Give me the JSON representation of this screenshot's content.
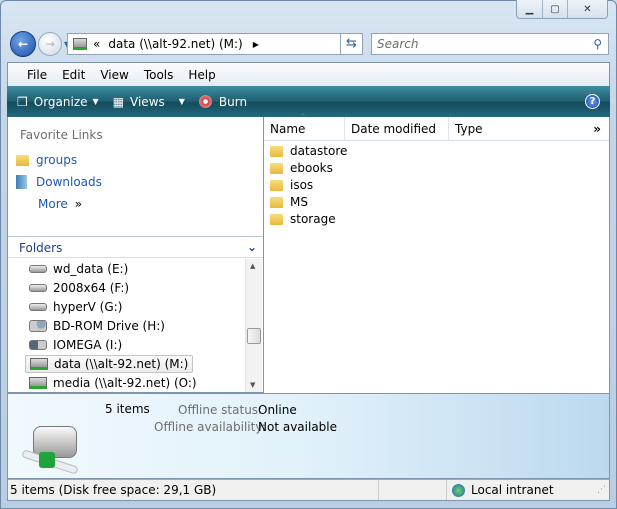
{
  "window": {
    "minimize": "minimize",
    "maximize": "maximize",
    "close": "close"
  },
  "nav": {
    "address_prefix": "«",
    "address": "data (\\\\alt-92.net) (M:)",
    "search_placeholder": "Search"
  },
  "menu": [
    "File",
    "Edit",
    "View",
    "Tools",
    "Help"
  ],
  "toolbar": {
    "organize": "Organize",
    "views": "Views",
    "burn": "Burn"
  },
  "favorites": {
    "header": "Favorite Links",
    "items": [
      "groups",
      "Downloads"
    ],
    "more": "More"
  },
  "folders": {
    "header": "Folders",
    "items": [
      {
        "label": "wd_data (E:)",
        "type": "drive"
      },
      {
        "label": "2008x64 (F:)",
        "type": "drive"
      },
      {
        "label": "hyperV (G:)",
        "type": "drive"
      },
      {
        "label": "BD-ROM Drive (H:)",
        "type": "optical"
      },
      {
        "label": "IOMEGA (I:)",
        "type": "removable"
      },
      {
        "label": "data (\\\\alt-92.net) (M:)",
        "type": "network",
        "selected": true
      },
      {
        "label": "media (\\\\alt-92.net) (O:)",
        "type": "network"
      }
    ]
  },
  "columns": [
    "Name",
    "Date modified",
    "Type"
  ],
  "files": [
    "datastore",
    "ebooks",
    "isos",
    "MS",
    "storage"
  ],
  "details": {
    "count": "5 items",
    "offline_status_label": "Offline status:",
    "offline_status": "Online",
    "offline_avail_label": "Offline availability:",
    "offline_avail": "Not available"
  },
  "status": {
    "text": "5 items (Disk free space: 29,1 GB)",
    "zone": "Local intranet"
  }
}
